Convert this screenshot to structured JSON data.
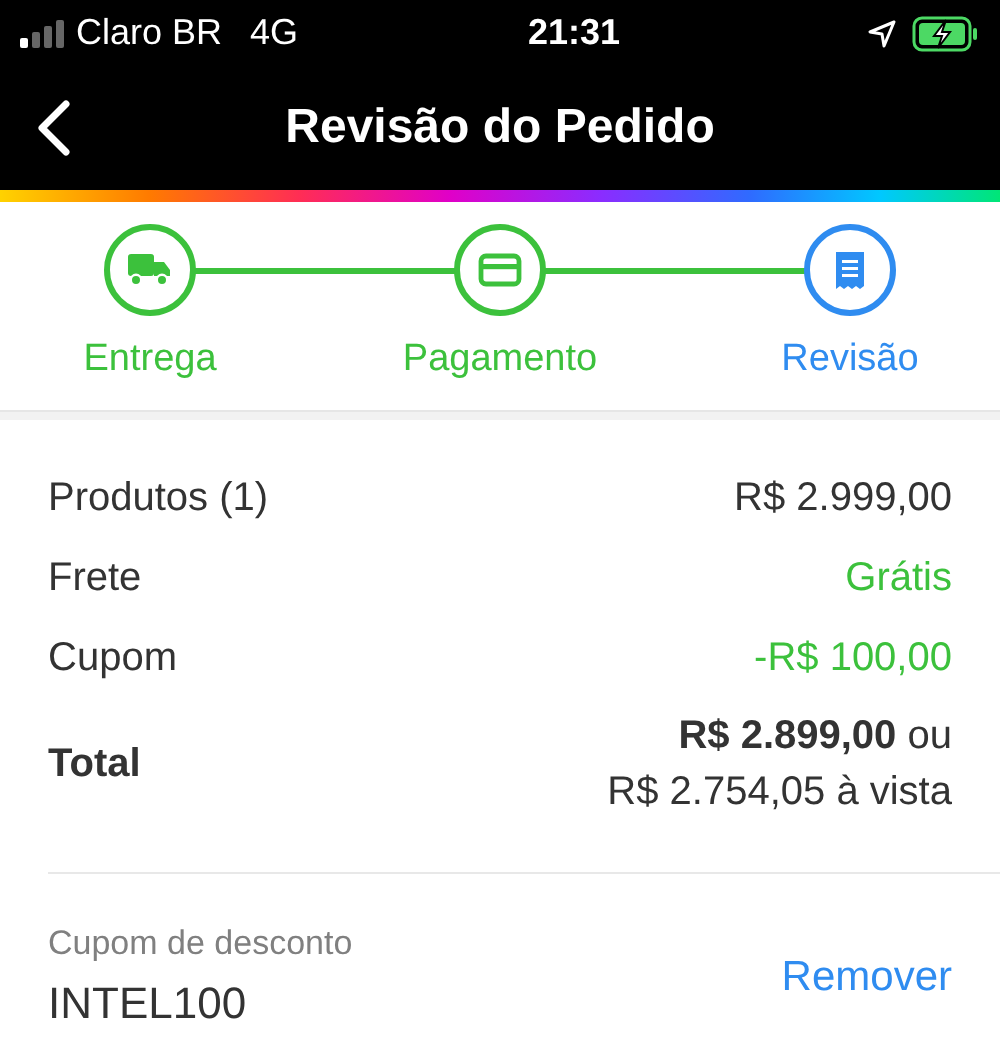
{
  "status_bar": {
    "carrier": "Claro BR",
    "network": "4G",
    "time": "21:31",
    "charging": true
  },
  "nav": {
    "title": "Revisão do Pedido"
  },
  "steps": [
    {
      "label": "Entrega",
      "selected": false
    },
    {
      "label": "Pagamento",
      "selected": false
    },
    {
      "label": "Revisão",
      "selected": true
    }
  ],
  "summary": [
    {
      "kind": "line",
      "label": "Produtos (1)",
      "value": "R$ 2.999,00",
      "color": "#333333"
    },
    {
      "kind": "line",
      "label": "Frete",
      "value": "Grátis",
      "color": "#3cc13c"
    },
    {
      "kind": "line",
      "label": "Cupom",
      "value": "-R$ 100,00",
      "color": "#3cc13c"
    },
    {
      "kind": "total",
      "label": "Total",
      "value": "**R$ 2.899,00** ou",
      "value_2": "R$ 2.754,05 à vista"
    }
  ],
  "coupon": {
    "label": "Cupom de desconto",
    "code": "INTEL100",
    "action": "Remover"
  }
}
